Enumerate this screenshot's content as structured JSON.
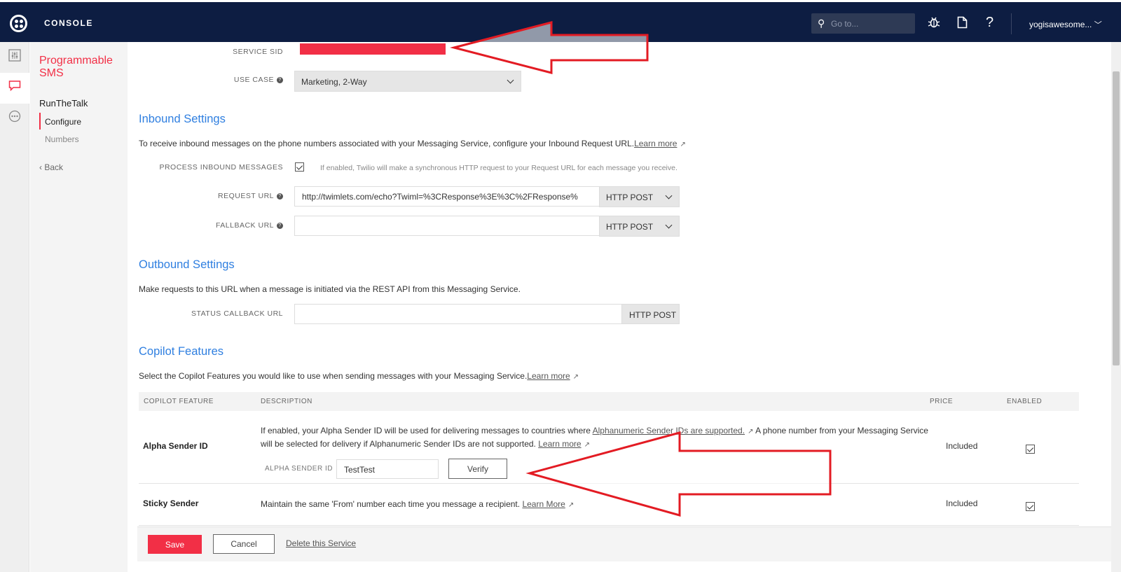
{
  "topbar": {
    "brand": "CONSOLE",
    "search_placeholder": "Go to...",
    "user": "yogisawesome..."
  },
  "icons": {
    "search": "magnifier-icon",
    "debugger": "bug-icon",
    "docs": "document-icon",
    "help": "question-icon",
    "user_menu": "chevron-down-icon"
  },
  "rail": {
    "items": [
      "dashboard-icon",
      "sms-icon",
      "more-icon"
    ]
  },
  "sidebar": {
    "title": "Programmable SMS",
    "service": "RunTheTalk",
    "links": [
      "Configure",
      "Numbers"
    ],
    "back": "‹ Back"
  },
  "service": {
    "sid_label": "SERVICE SID",
    "use_case_label": "USE CASE",
    "use_case_value": "Marketing, 2-Way"
  },
  "inbound": {
    "heading": "Inbound Settings",
    "description": "To receive inbound messages on the phone numbers associated with your Messaging Service, configure your Inbound Request URL.",
    "learn_more": "Learn more",
    "process_label": "PROCESS INBOUND MESSAGES",
    "process_hint": "If enabled, Twilio will make a synchronous HTTP request to your Request URL for each message you receive.",
    "request_url_label": "REQUEST URL",
    "request_url_value": "http://twimlets.com/echo?Twiml=%3CResponse%3E%3C%2FResponse%",
    "request_method": "HTTP POST",
    "fallback_url_label": "FALLBACK URL",
    "fallback_url_value": "",
    "fallback_method": "HTTP POST"
  },
  "outbound": {
    "heading": "Outbound Settings",
    "description": "Make requests to this URL when a message is initiated via the REST API from this Messaging Service.",
    "status_callback_label": "STATUS CALLBACK URL",
    "status_callback_value": "",
    "status_method": "HTTP POST"
  },
  "copilot": {
    "heading": "Copilot Features",
    "description": "Select the Copilot Features you would like to use when sending messages with your Messaging Service.",
    "learn_more": "Learn more",
    "columns": [
      "COPILOT FEATURE",
      "DESCRIPTION",
      "PRICE",
      "ENABLED"
    ],
    "alpha": {
      "name": "Alpha Sender ID",
      "desc_part1": "If enabled, your Alpha Sender ID will be used for delivering messages to countries where",
      "link_a": "Alphanumeric Sender IDs are supported.",
      "desc_part2": "A phone number from your Messaging Service",
      "desc_line2": "will be selected for delivery if Alphanumeric Sender IDs are not supported.",
      "learn_more": "Learn more",
      "field_label": "ALPHA SENDER ID",
      "field_value": "TestTest",
      "verify": "Verify",
      "price": "Included"
    },
    "sticky": {
      "name": "Sticky Sender",
      "desc": "Maintain the same 'From' number each time you message a recipient.",
      "learn_more": "Learn More",
      "price": "Included"
    }
  },
  "footer": {
    "save": "Save",
    "cancel": "Cancel",
    "delete": "Delete this Service"
  },
  "colors": {
    "navy": "#0d1d42",
    "brand_red": "#f22f46",
    "link_blue": "#2f7fe0",
    "annotation_red": "#e31b23"
  }
}
